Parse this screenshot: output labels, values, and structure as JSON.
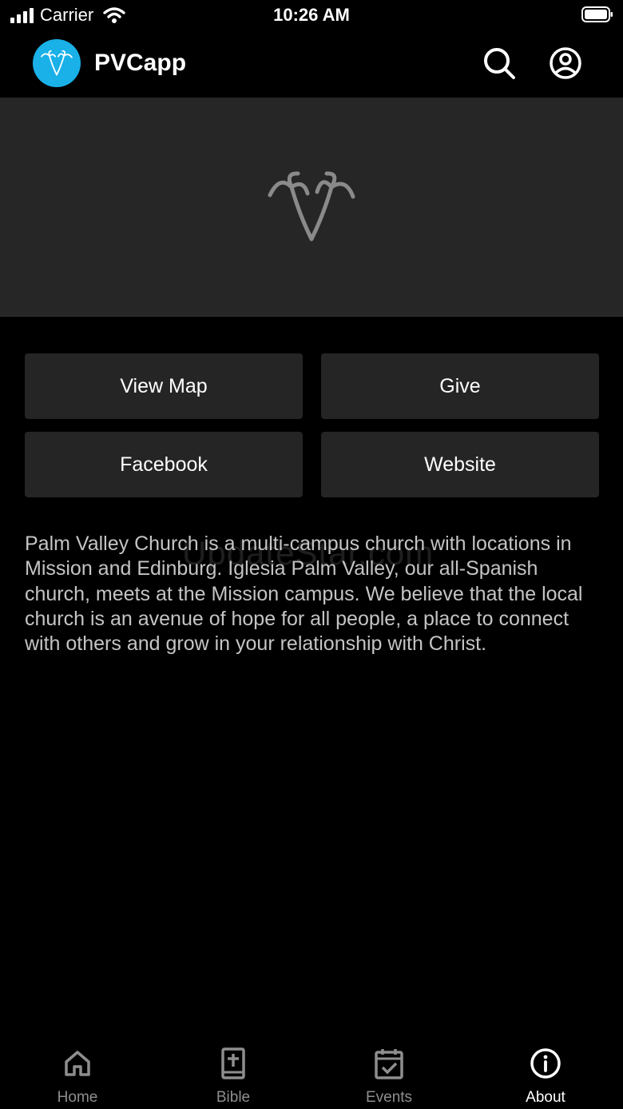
{
  "status_bar": {
    "carrier": "Carrier",
    "time": "10:26 AM"
  },
  "header": {
    "title": "PVCapp",
    "search_icon": "search-icon",
    "profile_icon": "user-circle-icon"
  },
  "buttons": {
    "view_map": "View Map",
    "give": "Give",
    "facebook": "Facebook",
    "website": "Website"
  },
  "description": "Palm Valley Church is a multi-campus church with locations in Mission and Edinburg. Iglesia Palm Valley, our all-Spanish church, meets at the Mission campus. We believe that the local church is an avenue of hope for all people, a place to connect with others and grow in your relationship with Christ.",
  "watermark": "UpdateStar.com",
  "tabs": [
    {
      "label": "Home",
      "icon": "home-icon",
      "active": false
    },
    {
      "label": "Bible",
      "icon": "bible-icon",
      "active": false
    },
    {
      "label": "Events",
      "icon": "calendar-check-icon",
      "active": false
    },
    {
      "label": "About",
      "icon": "info-icon",
      "active": true
    }
  ],
  "colors": {
    "accent": "#1ab0e8",
    "background": "#000000",
    "hero": "#262626",
    "button": "#252525"
  }
}
